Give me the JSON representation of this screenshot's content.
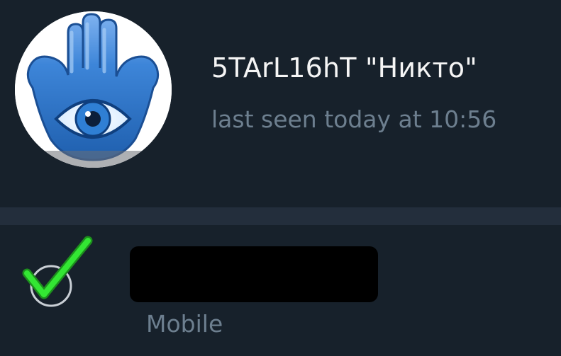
{
  "profile": {
    "name": "5TArL16hT \"Никто\"",
    "status": "last seen today at 10:56",
    "avatar_icon": "hamsa-eye-icon"
  },
  "info": {
    "icon": "check-circle-icon",
    "phone_label": "Mobile"
  },
  "colors": {
    "background": "#17212b",
    "divider": "#232e3c",
    "name_text": "#f5f5f5",
    "secondary_text": "#6d7f8f",
    "check_green": "#22dd22",
    "avatar_blue": "#2a79cc"
  }
}
